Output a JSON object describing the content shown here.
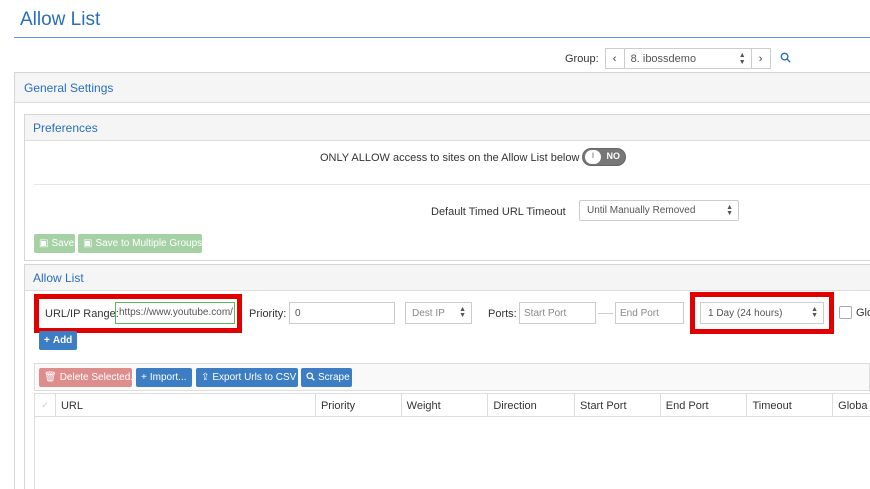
{
  "page": {
    "title": "Allow List"
  },
  "group": {
    "label": "Group:",
    "prev": "‹",
    "next": "›",
    "selected": "8. ibossdemo"
  },
  "general": {
    "header": "General Settings"
  },
  "preferences": {
    "header": "Preferences",
    "only_allow_label": "ONLY ALLOW access to sites on the Allow List below",
    "toggle_state": "NO",
    "timeout_label": "Default Timed URL Timeout",
    "timeout_value": "Until Manually Removed",
    "save_label": "Save",
    "save_multi_label": "Save to Multiple Groups"
  },
  "allow_list": {
    "header": "Allow List",
    "url_label": "URL/IP Range:",
    "url_value": "https://www.youtube.com/",
    "priority_label": "Priority:",
    "priority_value": "0",
    "dest_select": "Dest IP",
    "ports_label": "Ports:",
    "start_port_placeholder": "Start Port",
    "end_port_placeholder": "End Port",
    "timeout_value": "1 Day (24 hours)",
    "global_label": "Glo",
    "add_label": "Add"
  },
  "toolbar": {
    "delete_label": "Delete Selected...",
    "import_label": "Import...",
    "export_label": "Export Urls to CSV",
    "scrape_label": "Scrape"
  },
  "table": {
    "columns": [
      "URL",
      "Priority",
      "Weight",
      "Direction",
      "Start Port",
      "End Port",
      "Timeout",
      "Globa"
    ]
  },
  "colors": {
    "accent": "#2a6ebb",
    "highlight": "#e00000",
    "success": "#a5d1a5",
    "primary": "#3c7dc4",
    "danger": "#de8d8d"
  }
}
